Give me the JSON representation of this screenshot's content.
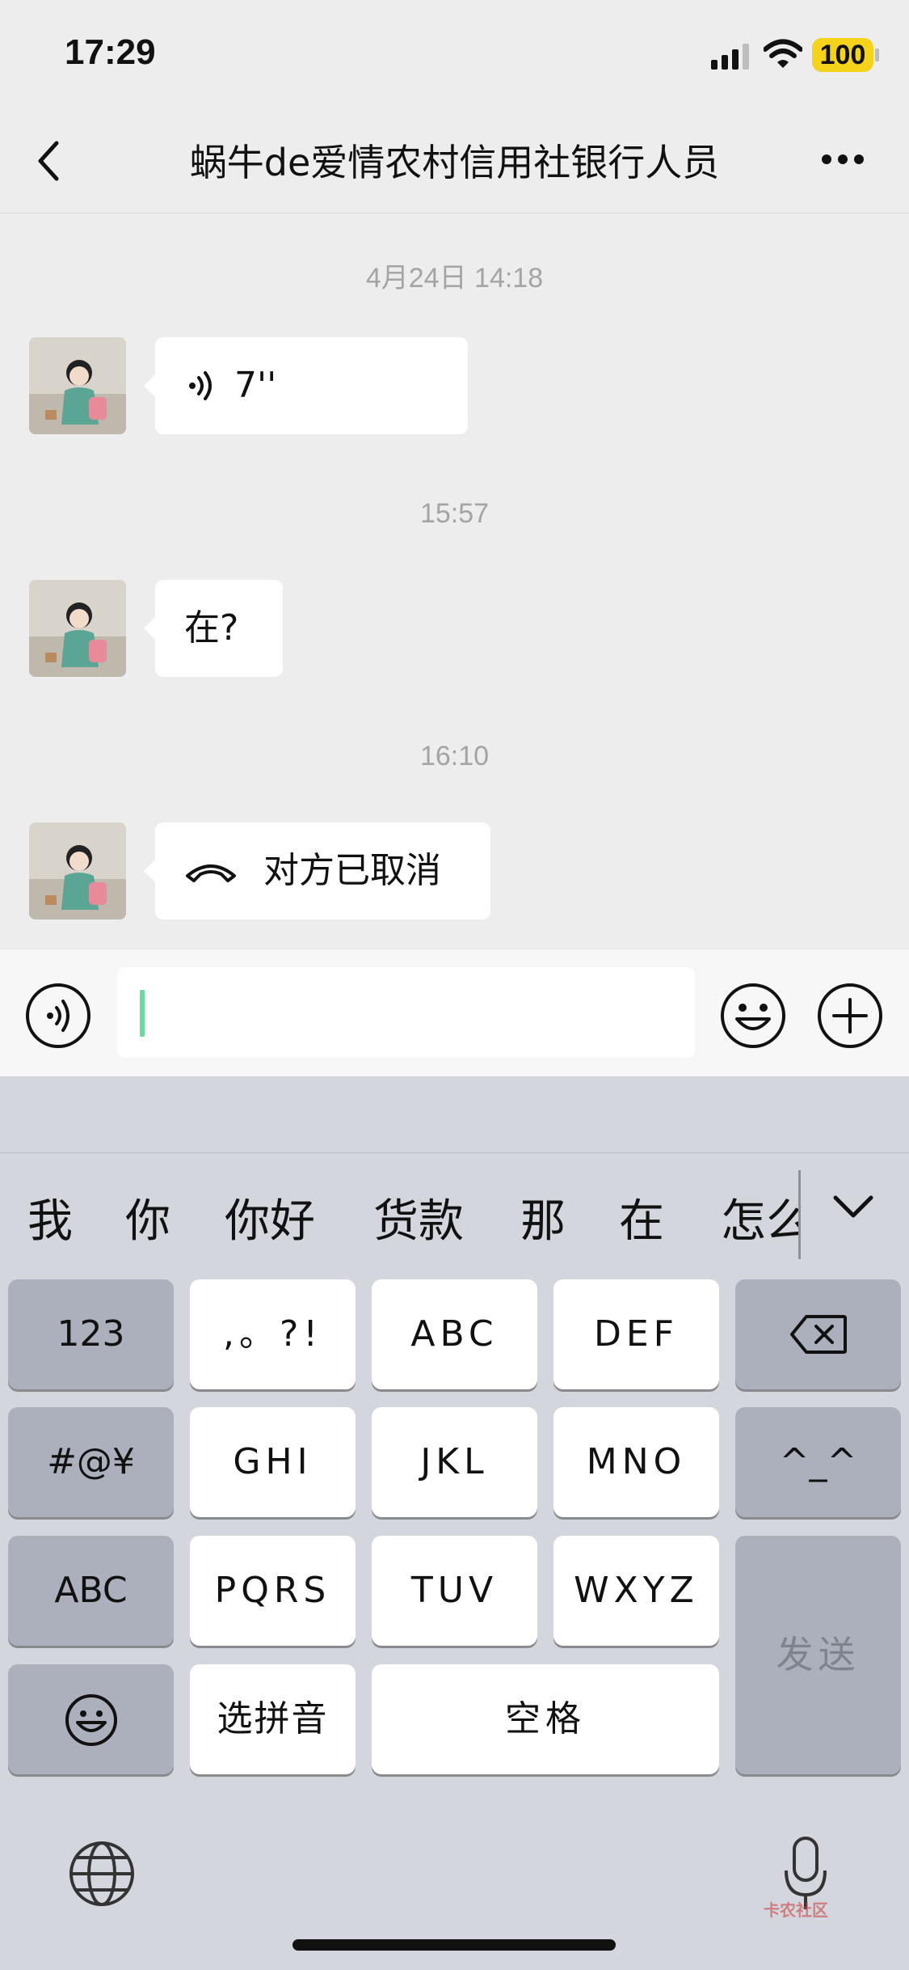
{
  "status_bar": {
    "time": "17:29",
    "battery": "100"
  },
  "nav": {
    "title": "蜗牛de爱情农村信用社银行人员"
  },
  "messages": [
    {
      "timestamp": "4月24日 14:18",
      "text": "7''"
    },
    {
      "timestamp": "15:57",
      "text": "在?"
    },
    {
      "timestamp": "16:10",
      "text": "对方已取消"
    }
  ],
  "candidates": [
    "我",
    "你",
    "你好",
    "货款",
    "那",
    "在",
    "怎么"
  ],
  "keyboard": {
    "row1": [
      "123",
      ",。?!",
      "ABC",
      "DEF"
    ],
    "row2": [
      "#@¥",
      "GHI",
      "JKL",
      "MNO",
      "^_^"
    ],
    "row3": [
      "ABC",
      "PQRS",
      "TUV",
      "WXYZ"
    ],
    "row4": [
      "选拼音",
      "空格"
    ],
    "send": "发送"
  },
  "watermark": {
    "text": "卡农社区"
  },
  "colors": {
    "accent": "#07c160",
    "battery": "#f5d31b",
    "keyboard_bg": "#d3d6dd",
    "chat_bg": "#ededed"
  }
}
